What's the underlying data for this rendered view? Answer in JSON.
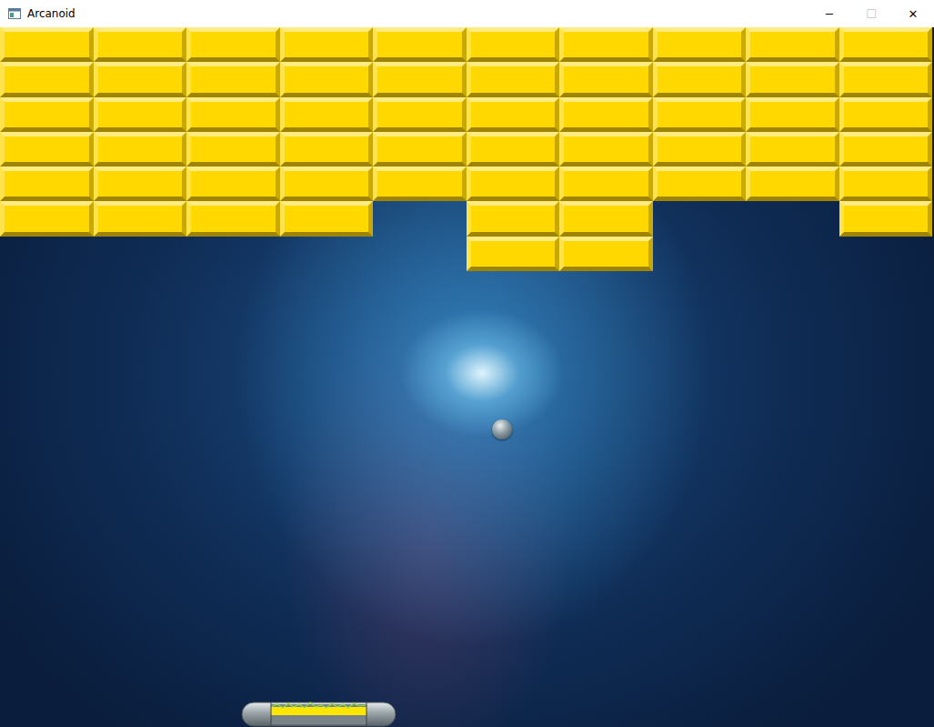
{
  "window": {
    "title": "Arcanoid",
    "controls": [
      {
        "label": "─",
        "disabled": false
      },
      {
        "label": "☐",
        "disabled": true
      },
      {
        "label": "✕",
        "disabled": false
      }
    ]
  },
  "bricks": [
    [
      true,
      true,
      true,
      true,
      true,
      true,
      true,
      true,
      true,
      true
    ],
    [
      true,
      true,
      true,
      true,
      true,
      true,
      true,
      true,
      true,
      true
    ],
    [
      true,
      true,
      true,
      true,
      true,
      true,
      true,
      true,
      true,
      true
    ],
    [
      true,
      true,
      true,
      true,
      true,
      true,
      true,
      true,
      true,
      true
    ],
    [
      true,
      true,
      true,
      true,
      true,
      true,
      true,
      true,
      true,
      true
    ],
    [
      true,
      true,
      true,
      true,
      false,
      true,
      true,
      false,
      false,
      true
    ],
    [
      false,
      false,
      false,
      false,
      false,
      true,
      true,
      false,
      false,
      false
    ]
  ]
}
